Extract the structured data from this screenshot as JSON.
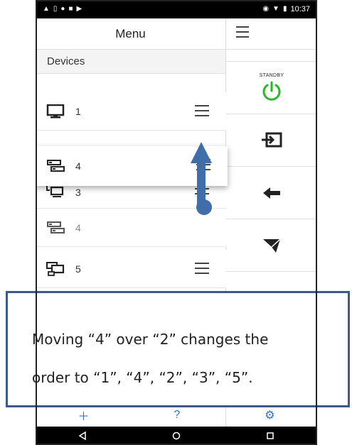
{
  "status_bar": {
    "time": "10:37",
    "icons_left": [
      "warning-icon",
      "sim-icon",
      "app-icon",
      "app-icon",
      "play-icon"
    ],
    "icons_right": [
      "signal-icon",
      "wifi-icon",
      "battery-icon"
    ]
  },
  "menu": {
    "title": "Menu",
    "section": "Devices",
    "devices": [
      {
        "number": "1",
        "icon": "monitor-icon"
      },
      {
        "number": "4",
        "icon": "server-icon",
        "state": "dragging"
      },
      {
        "number": "3",
        "icon": "display-network-icon"
      },
      {
        "number": "4",
        "icon": "server-icon",
        "state": "ghost"
      },
      {
        "number": "5",
        "icon": "monitor-network-icon"
      }
    ]
  },
  "controls": {
    "standby_label": "STANDBY",
    "standby_color": "#22bb22",
    "buttons": [
      "power-icon",
      "input-icon",
      "back-icon",
      "send-icon"
    ]
  },
  "bottom_bar": [
    "add-icon",
    "help-icon",
    "settings-icon"
  ],
  "nav_bar": [
    "back-triangle-icon",
    "home-circle-icon",
    "recents-square-icon"
  ],
  "callout": {
    "line1": "Moving “4” over “2” changes the",
    "line2": "order to “1”, “4”, “2”, “3”, “5”."
  },
  "colors": {
    "arrow": "#3f6ea8",
    "callout_border": "#3a5a8a",
    "toolbar_icon": "#2f6fd6"
  }
}
